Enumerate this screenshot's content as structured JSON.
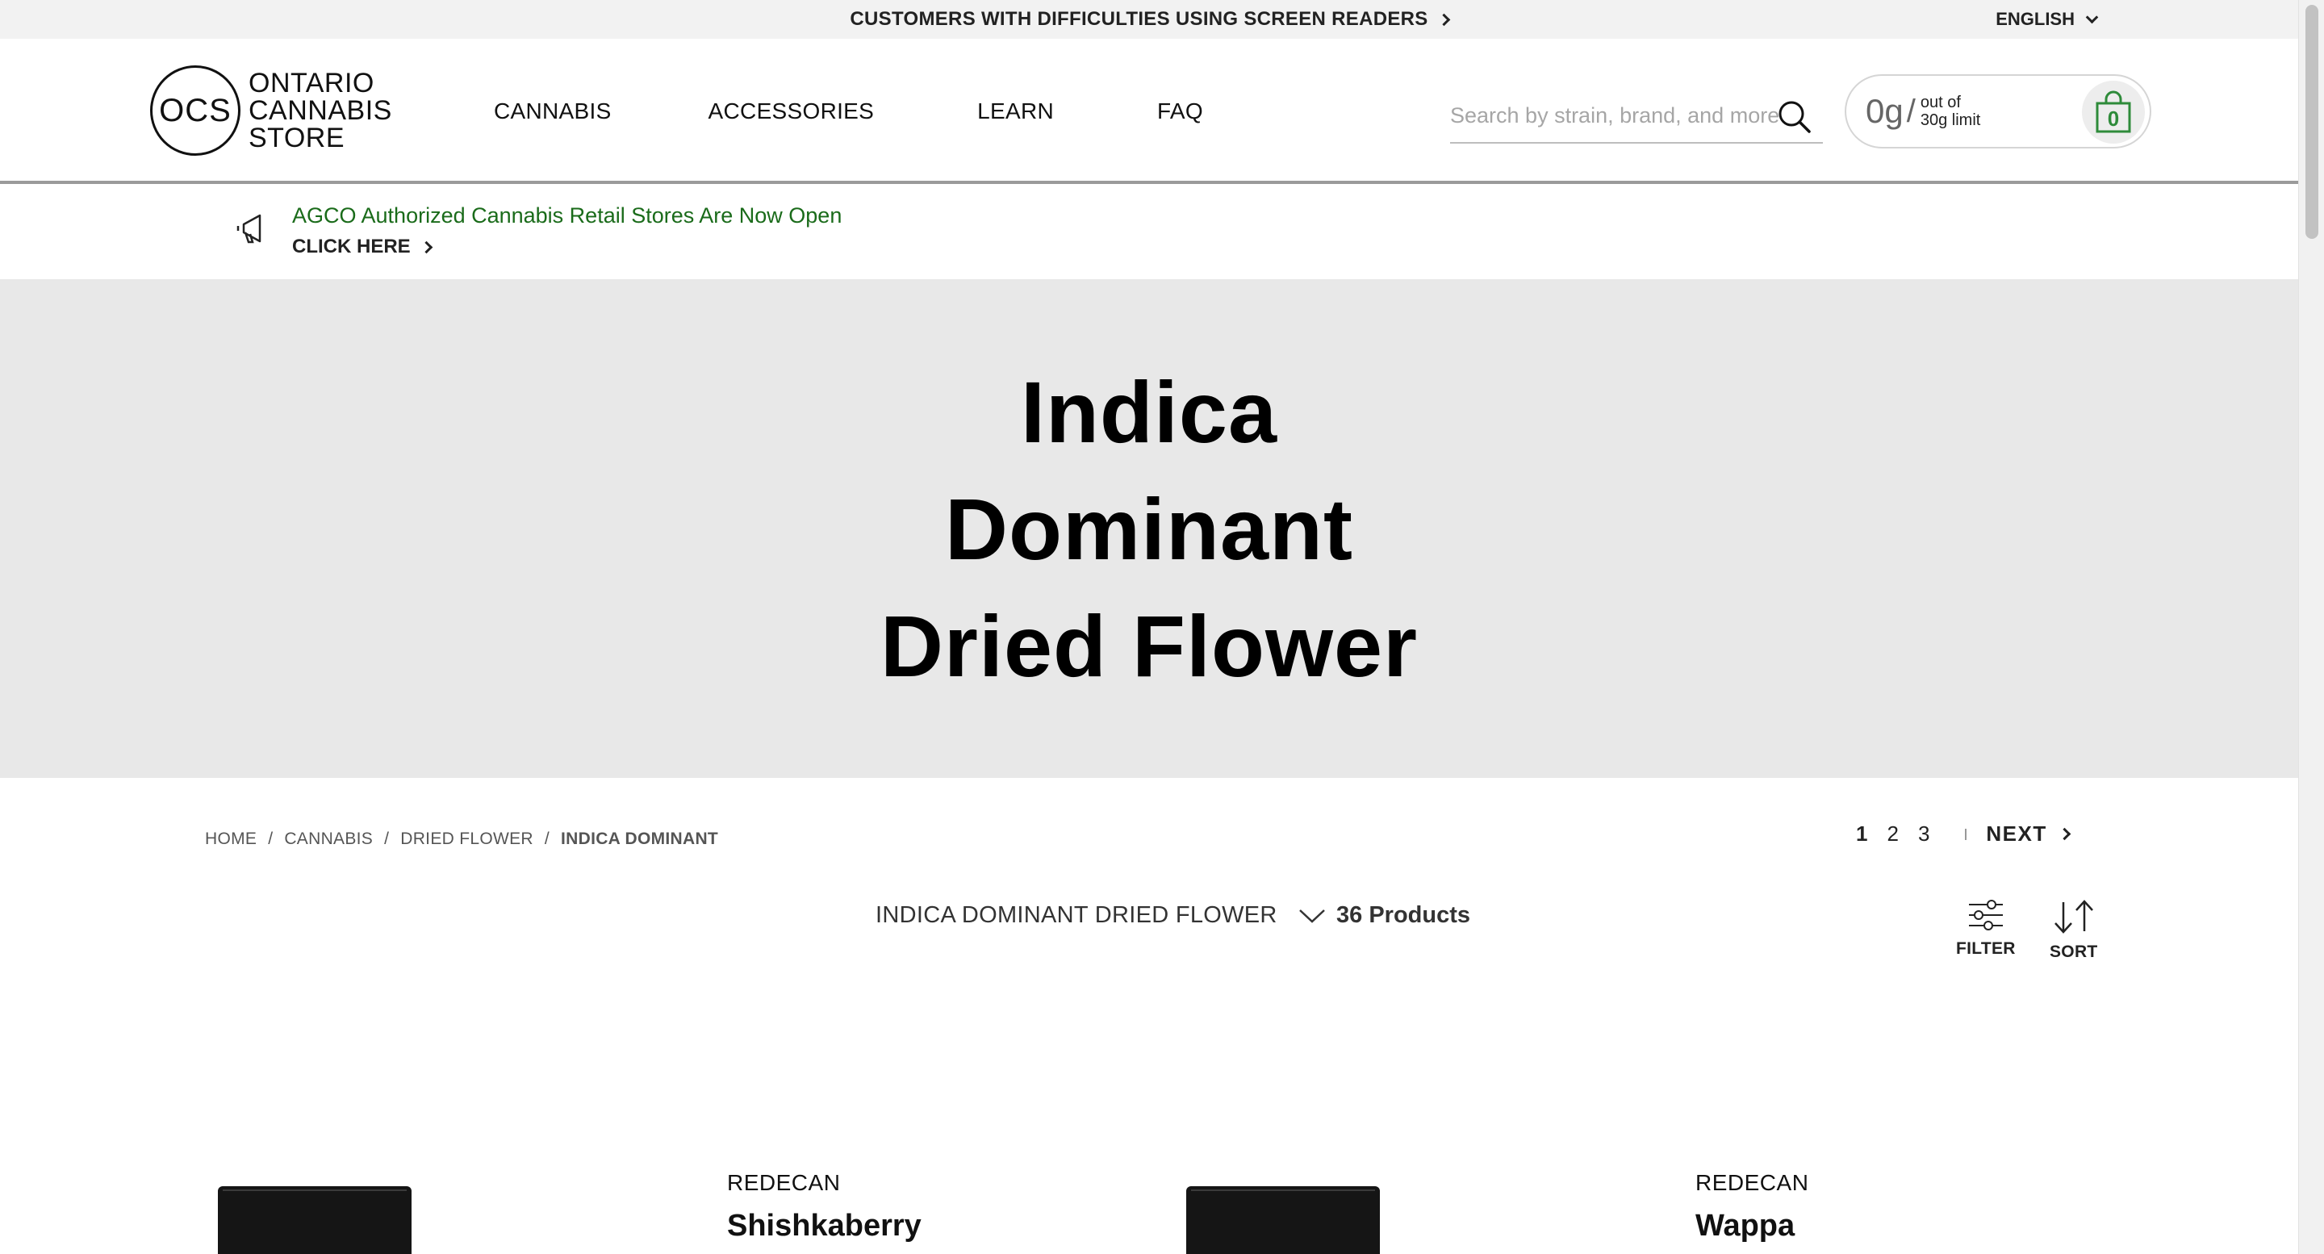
{
  "access_bar": {
    "link_label": "CUSTOMERS WITH DIFFICULTIES USING SCREEN READERS",
    "language": "ENGLISH"
  },
  "header": {
    "logo": {
      "mark": "OCS",
      "line1": "ONTARIO",
      "line2": "CANNABIS",
      "line3": "STORE"
    },
    "nav": [
      "CANNABIS",
      "ACCESSORIES",
      "LEARN",
      "FAQ"
    ],
    "search": {
      "placeholder": "Search by strain, brand, and more",
      "value": ""
    },
    "limit": {
      "grams": "0g",
      "slash": "/",
      "line1": "out of",
      "line2": "30g limit"
    },
    "cart_count": "0"
  },
  "announcement": {
    "title": "AGCO Authorized Cannabis Retail Stores Are Now Open",
    "cta": "CLICK HERE"
  },
  "hero": {
    "title": "Indica Dominant Dried Flower"
  },
  "breadcrumb": [
    "HOME",
    "CANNABIS",
    "DRIED FLOWER",
    "INDICA DOMINANT"
  ],
  "pagination": {
    "pages": [
      "1",
      "2",
      "3"
    ],
    "current": "1",
    "next_label": "NEXT"
  },
  "listing": {
    "category": "INDICA DOMINANT DRIED FLOWER",
    "count": "36 Products",
    "filter_label": "FILTER",
    "sort_label": "SORT"
  },
  "products": [
    {
      "brand": "REDECAN",
      "name": "Shishkaberry"
    },
    {
      "brand": "REDECAN",
      "name": "Wappa"
    }
  ],
  "colors": {
    "announcement_green": "#1a6b1a",
    "hero_bg": "#e8e8e8",
    "bag_green": "#2e8b3a"
  },
  "icons": [
    "chevron-right-icon",
    "chevron-down-icon",
    "search-icon",
    "shopping-bag-icon",
    "megaphone-icon",
    "filter-icon",
    "sort-icon"
  ]
}
